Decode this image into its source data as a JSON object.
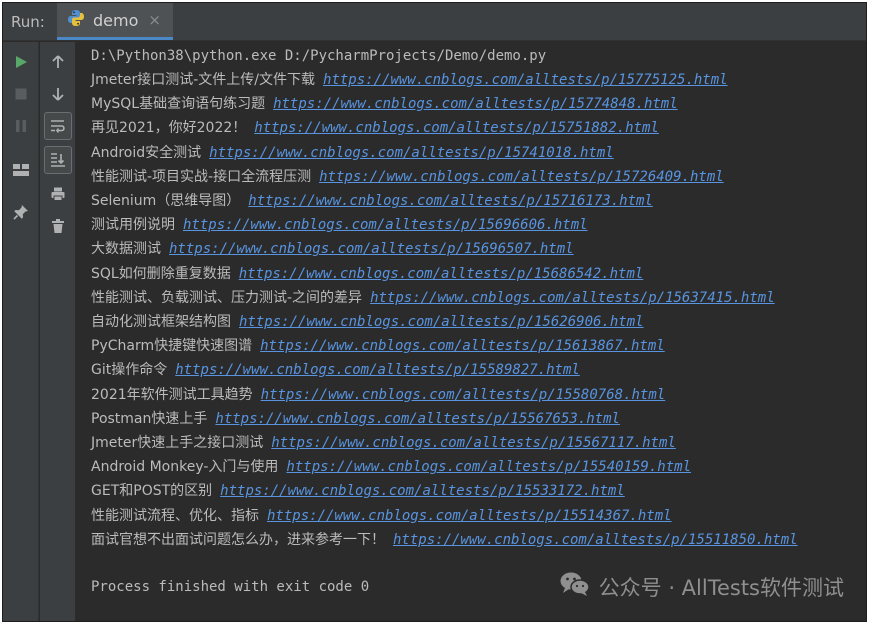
{
  "header": {
    "run_label": "Run:",
    "tab_label": "demo",
    "tab_close": "×"
  },
  "console": {
    "command": "D:\\Python38\\python.exe D:/PycharmProjects/Demo/demo.py",
    "entries": [
      {
        "title": "Jmeter接口测试-文件上传/文件下载",
        "url": "https://www.cnblogs.com/alltests/p/15775125.html"
      },
      {
        "title": "MySQL基础查询语句练习题",
        "url": "https://www.cnblogs.com/alltests/p/15774848.html"
      },
      {
        "title": "再见2021，你好2022！",
        "url": "https://www.cnblogs.com/alltests/p/15751882.html"
      },
      {
        "title": "Android安全测试",
        "url": "https://www.cnblogs.com/alltests/p/15741018.html"
      },
      {
        "title": "性能测试-项目实战-接口全流程压测",
        "url": "https://www.cnblogs.com/alltests/p/15726409.html"
      },
      {
        "title": "Selenium（思维导图）",
        "url": "https://www.cnblogs.com/alltests/p/15716173.html"
      },
      {
        "title": "测试用例说明",
        "url": "https://www.cnblogs.com/alltests/p/15696606.html"
      },
      {
        "title": "大数据测试",
        "url": "https://www.cnblogs.com/alltests/p/15696507.html"
      },
      {
        "title": "SQL如何删除重复数据",
        "url": "https://www.cnblogs.com/alltests/p/15686542.html"
      },
      {
        "title": "性能测试、负载测试、压力测试-之间的差异",
        "url": "https://www.cnblogs.com/alltests/p/15637415.html"
      },
      {
        "title": "自动化测试框架结构图",
        "url": "https://www.cnblogs.com/alltests/p/15626906.html"
      },
      {
        "title": "PyCharm快捷键快速图谱",
        "url": "https://www.cnblogs.com/alltests/p/15613867.html"
      },
      {
        "title": "Git操作命令",
        "url": "https://www.cnblogs.com/alltests/p/15589827.html"
      },
      {
        "title": "2021年软件测试工具趋势",
        "url": "https://www.cnblogs.com/alltests/p/15580768.html"
      },
      {
        "title": "Postman快速上手",
        "url": "https://www.cnblogs.com/alltests/p/15567653.html"
      },
      {
        "title": "Jmeter快速上手之接口测试",
        "url": "https://www.cnblogs.com/alltests/p/15567117.html"
      },
      {
        "title": "Android Monkey-入门与使用",
        "url": "https://www.cnblogs.com/alltests/p/15540159.html"
      },
      {
        "title": "GET和POST的区别",
        "url": "https://www.cnblogs.com/alltests/p/15533172.html"
      },
      {
        "title": "性能测试流程、优化、指标",
        "url": "https://www.cnblogs.com/alltests/p/15514367.html"
      },
      {
        "title": "面试官想不出面试问题怎么办，进来参考一下！",
        "url": "https://www.cnblogs.com/alltests/p/15511850.html"
      }
    ],
    "exit_message": "Process finished with exit code 0"
  },
  "watermark": {
    "text": "公众号 · AllTests软件测试"
  },
  "colors": {
    "background": "#2b2b2b",
    "panel": "#3c3f41",
    "text": "#bbbbbb",
    "link": "#5894e0",
    "run_green": "#59a869",
    "tab_accent": "#4a88c7"
  },
  "icons": [
    "python-icon",
    "run-icon",
    "stop-icon",
    "pause-icon",
    "layout-icon",
    "pin-icon",
    "arrow-up-icon",
    "arrow-down-icon",
    "soft-wrap-icon",
    "scroll-to-end-icon",
    "print-icon",
    "trash-icon",
    "wechat-icon"
  ]
}
